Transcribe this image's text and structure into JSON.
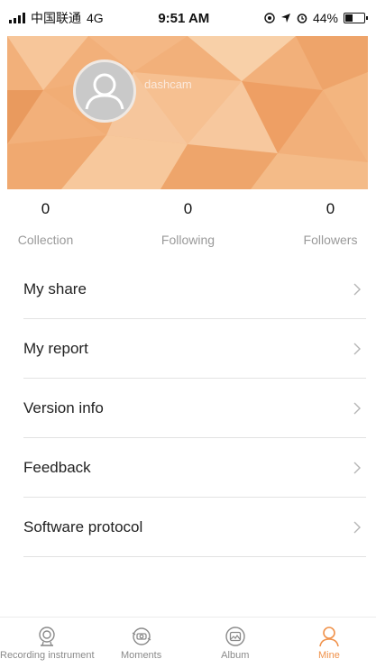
{
  "status_bar": {
    "carrier": "中国联通",
    "network": "4G",
    "time": "9:51 AM",
    "battery": "44%",
    "battery_level": 0.44
  },
  "profile": {
    "username": "dashcam"
  },
  "stats": [
    {
      "value": "0",
      "label": "Collection"
    },
    {
      "value": "0",
      "label": "Following"
    },
    {
      "value": "0",
      "label": "Followers"
    }
  ],
  "menu": [
    {
      "label": "My share"
    },
    {
      "label": "My report"
    },
    {
      "label": "Version info"
    },
    {
      "label": "Feedback"
    },
    {
      "label": "Software protocol"
    }
  ],
  "tabs": [
    {
      "label": "Recording instrument",
      "icon": "camera-icon",
      "active": false
    },
    {
      "label": "Moments",
      "icon": "moments-icon",
      "active": false
    },
    {
      "label": "Album",
      "icon": "album-icon",
      "active": false
    },
    {
      "label": "Mine",
      "icon": "person-icon",
      "active": true
    }
  ],
  "colors": {
    "accent": "#f0924b",
    "banner": "#f2b07a"
  }
}
